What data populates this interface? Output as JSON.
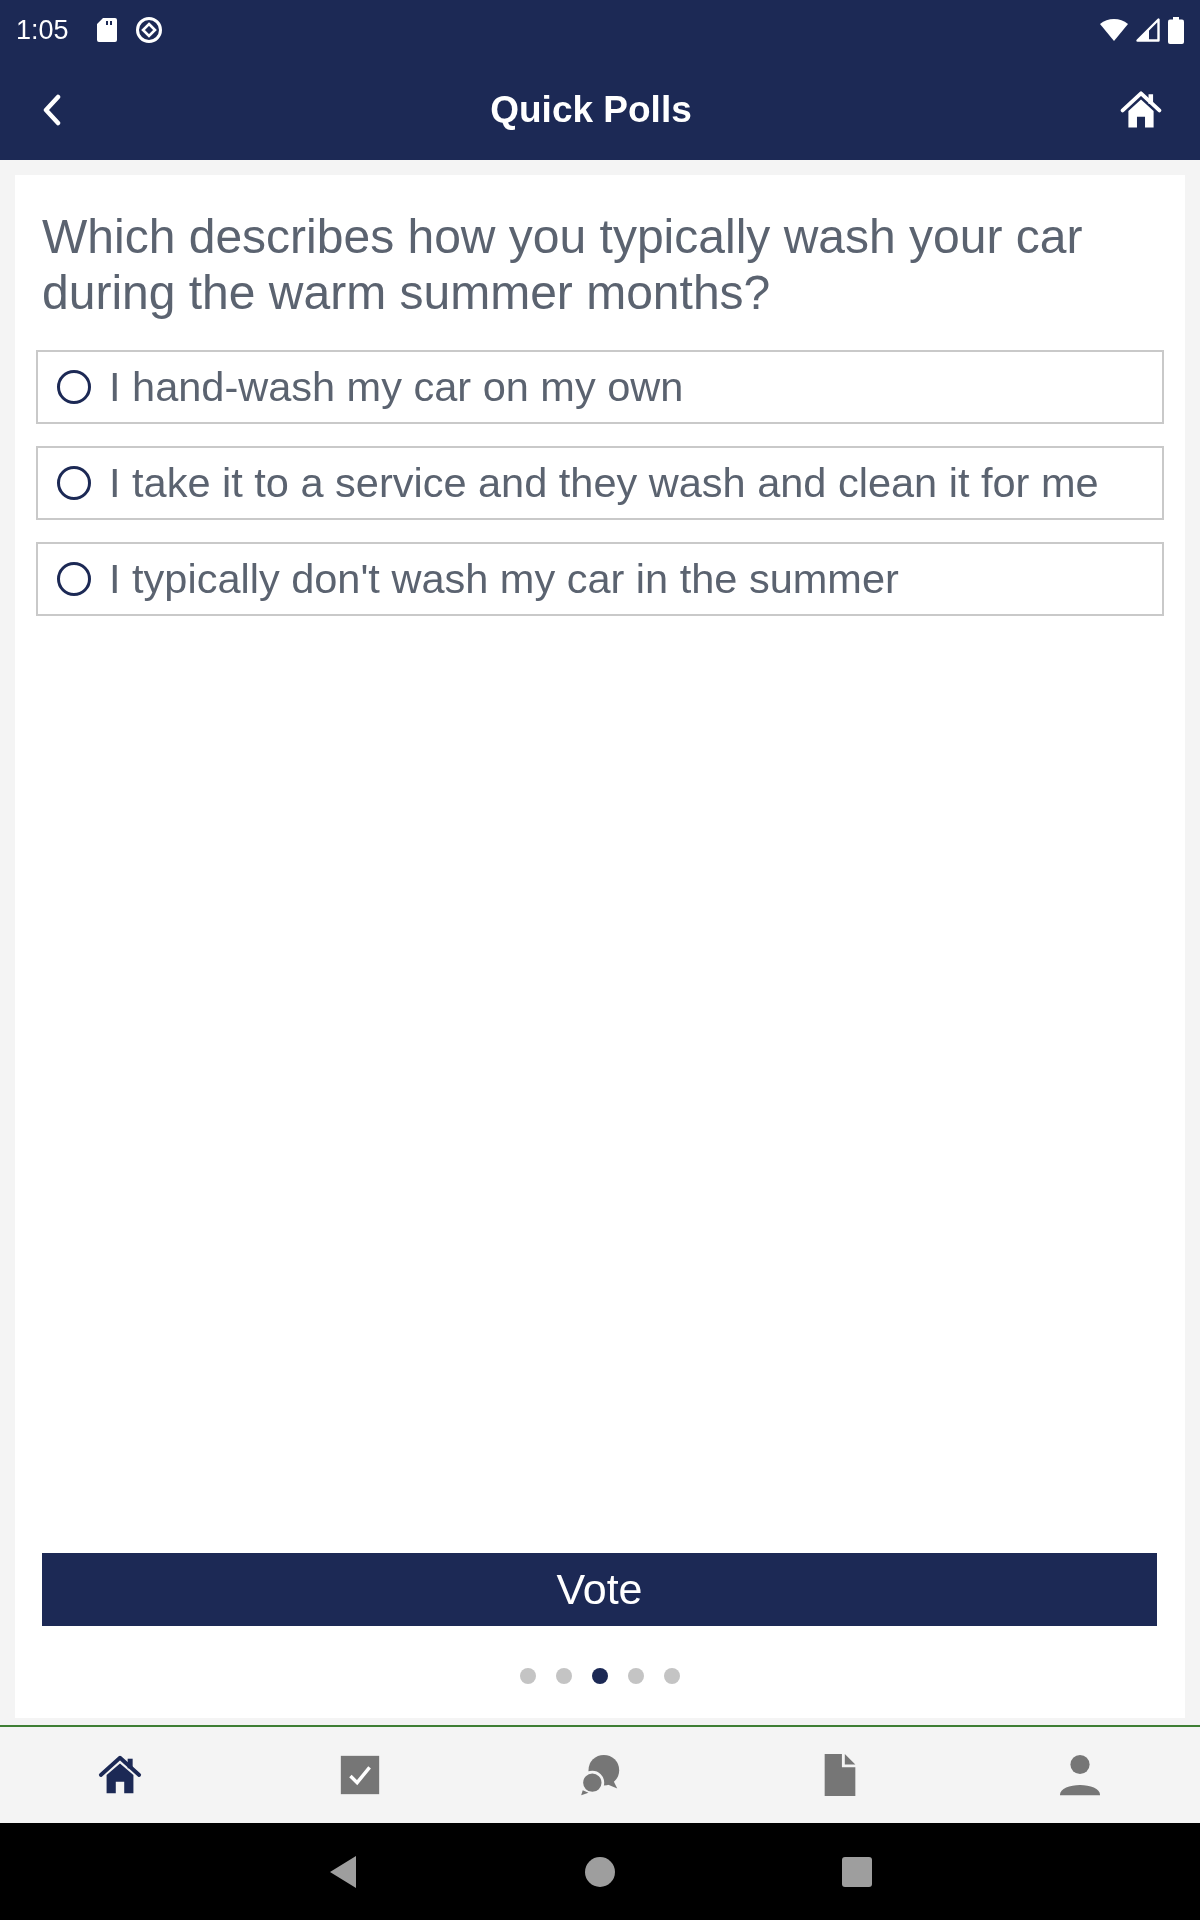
{
  "status_bar": {
    "time": "1:05"
  },
  "header": {
    "title": "Quick Polls"
  },
  "poll": {
    "question": "Which describes how you typically wash your car during the warm summer months?",
    "options": [
      {
        "label": "I hand-wash my car on my own",
        "selected": false
      },
      {
        "label": "I take it to a service and they wash and clean it for me",
        "selected": false
      },
      {
        "label": "I typically don't wash my car in the summer",
        "selected": false
      }
    ],
    "vote_button": "Vote"
  },
  "pager": {
    "dots": [
      {
        "selected": false
      },
      {
        "selected": false
      },
      {
        "selected": true
      },
      {
        "selected": false
      },
      {
        "selected": false
      }
    ]
  },
  "bottom_nav": {
    "items": [
      {
        "kind": "home",
        "selected": true
      },
      {
        "kind": "tasks",
        "selected": false
      },
      {
        "kind": "chat",
        "selected": false
      },
      {
        "kind": "document",
        "selected": false
      },
      {
        "kind": "profile",
        "selected": false
      }
    ]
  }
}
